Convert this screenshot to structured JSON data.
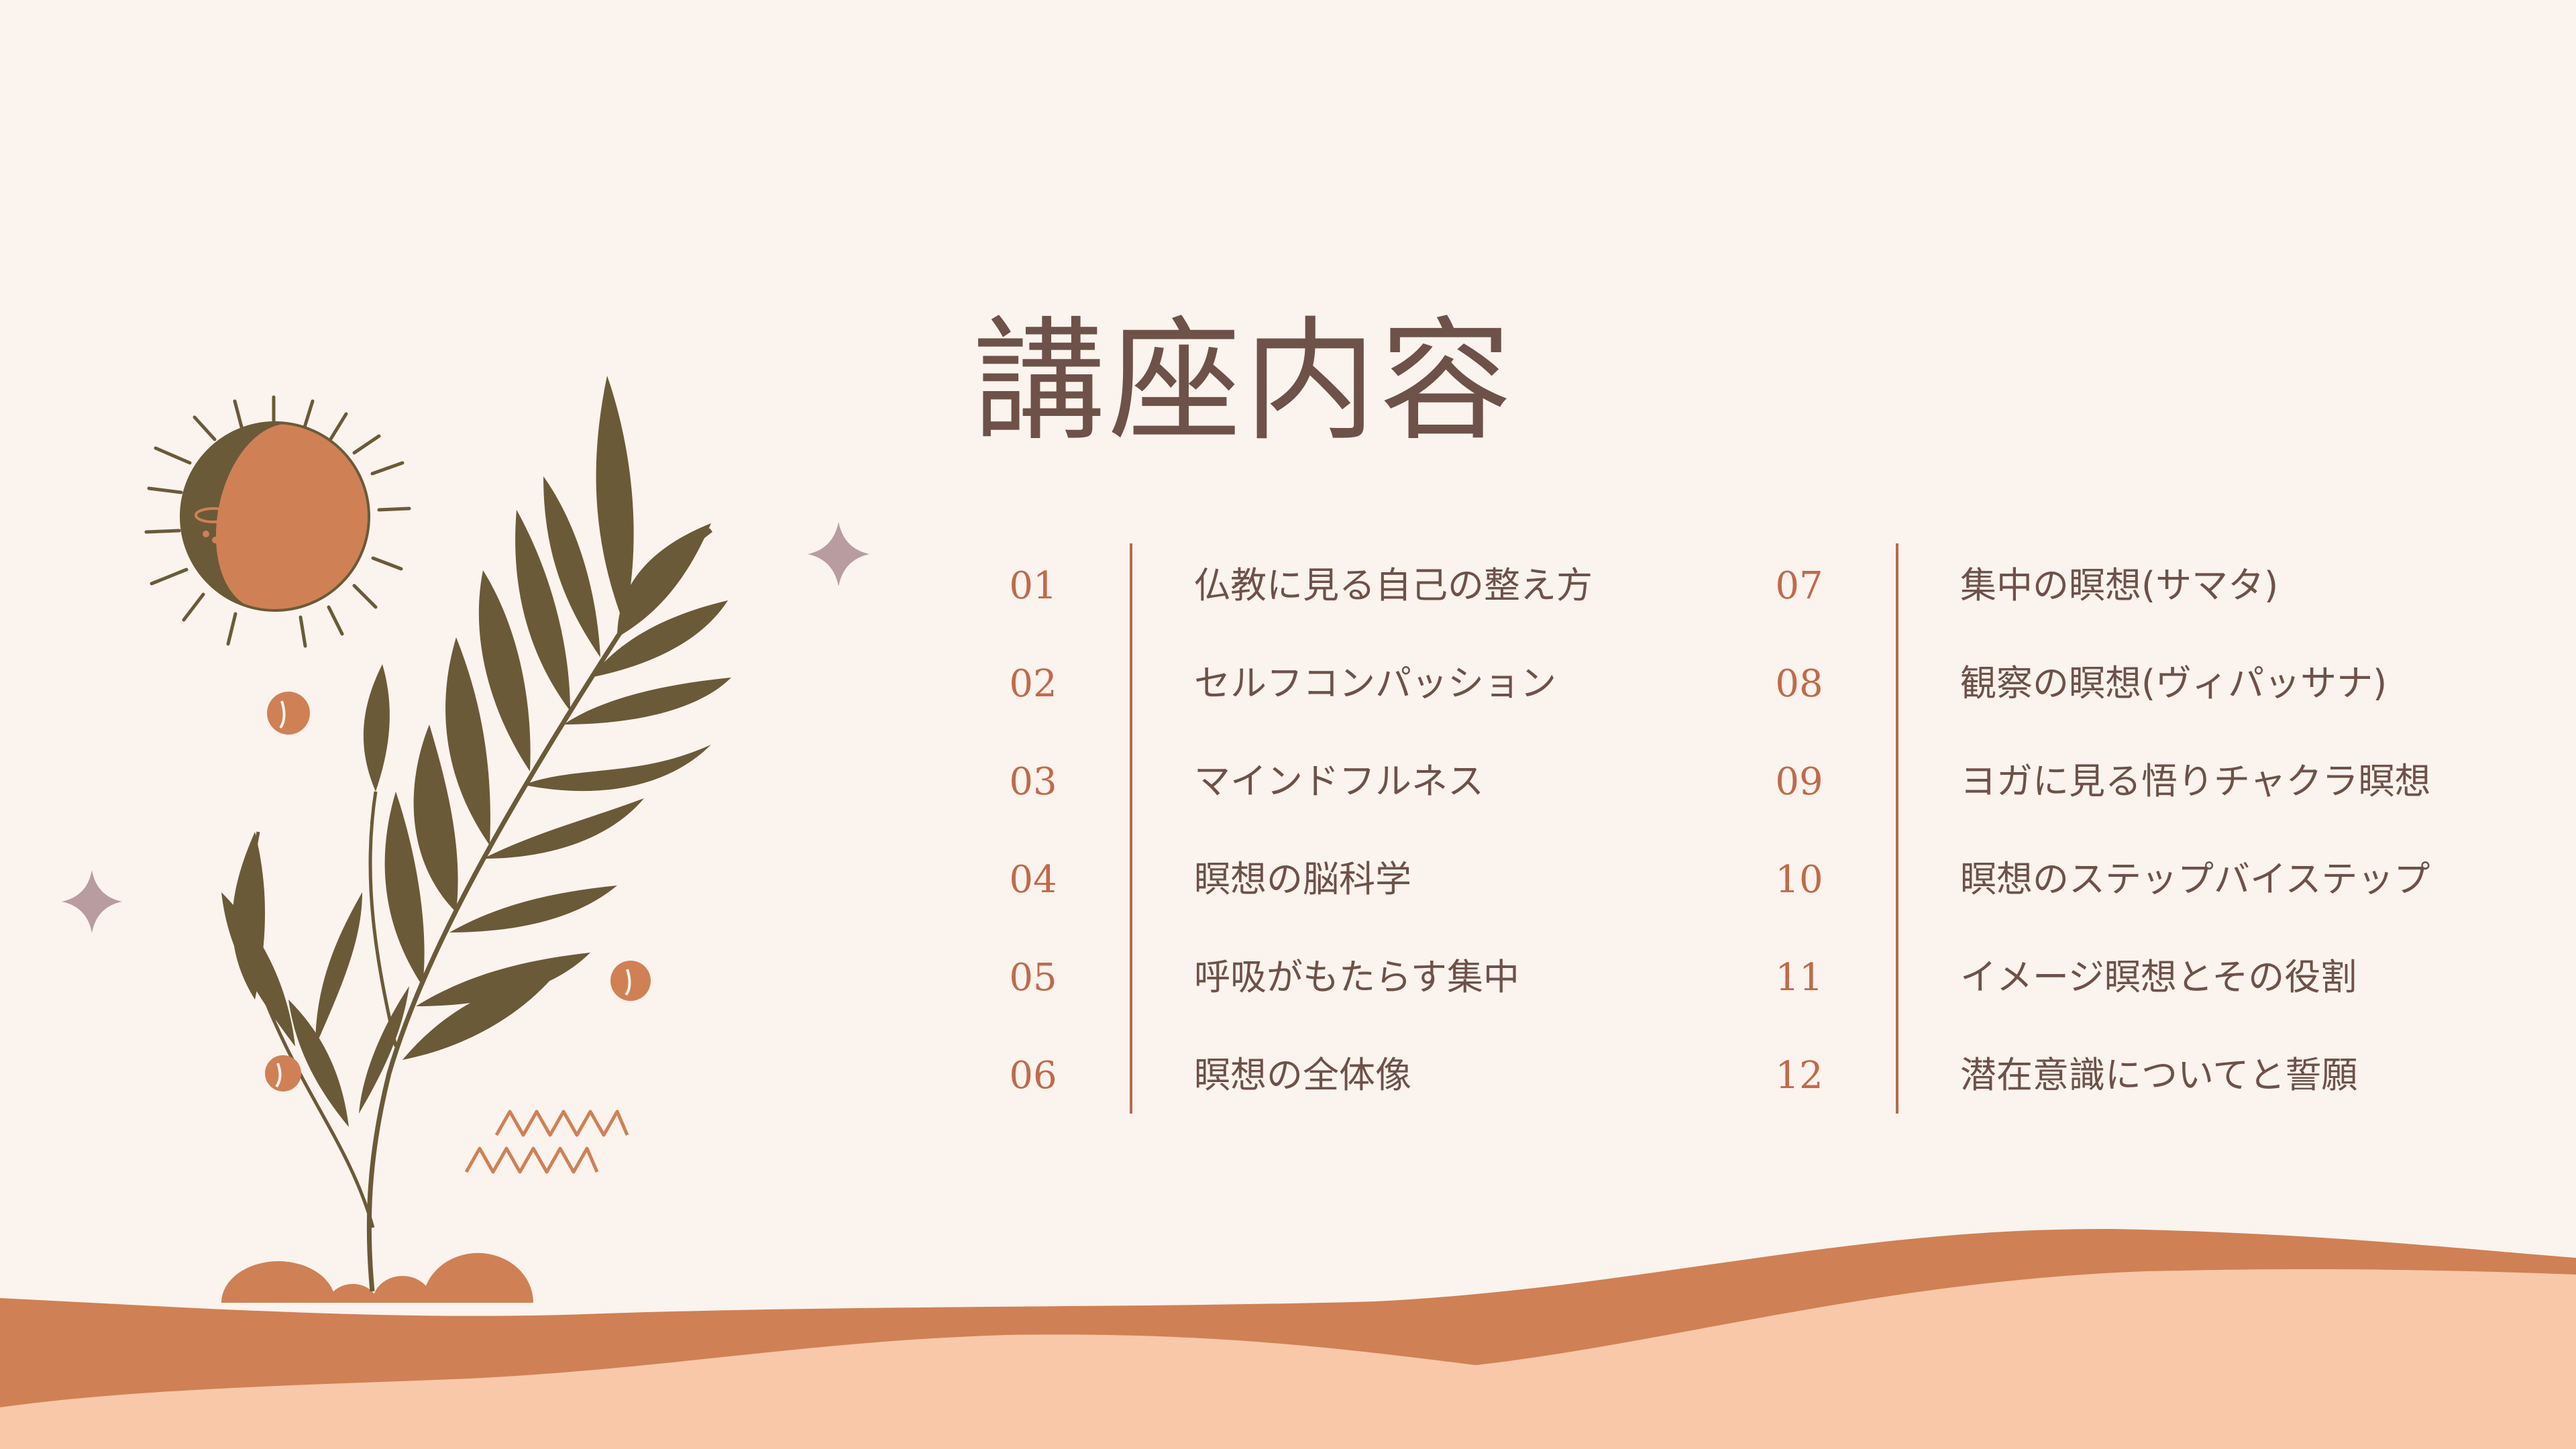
{
  "title": "講座内容",
  "left_column": [
    {
      "num": "01",
      "label": "仏教に見る自己の整え方"
    },
    {
      "num": "02",
      "label": "セルフコンパッション"
    },
    {
      "num": "03",
      "label": "マインドフルネス"
    },
    {
      "num": "04",
      "label": "瞑想の脳科学"
    },
    {
      "num": "05",
      "label": "呼吸がもたらす集中"
    },
    {
      "num": "06",
      "label": "瞑想の全体像"
    }
  ],
  "right_column": [
    {
      "num": "07",
      "label": "集中の瞑想(サマタ)"
    },
    {
      "num": "08",
      "label": "観察の瞑想(ヴィパッサナ)"
    },
    {
      "num": "09",
      "label": "ヨガに見る悟りチャクラ瞑想"
    },
    {
      "num": "10",
      "label": "瞑想のステップバイステップ"
    },
    {
      "num": "11",
      "label": "イメージ瞑想とその役割"
    },
    {
      "num": "12",
      "label": "潜在意識についてと誓願"
    }
  ],
  "colors": {
    "background": "#fbf3ed",
    "title_text": "#6e5149",
    "number_text": "#c06a4a",
    "divider": "#b46a4f",
    "olive": "#6b5a38",
    "terracotta": "#d08055",
    "peach": "#f8c8a8",
    "sparkle": "#b99ca0"
  },
  "icons": [
    "sun-icon",
    "leaf-plant-icon",
    "sparkle-icon",
    "zigzag-icon",
    "dot-icon",
    "dune-icon"
  ]
}
